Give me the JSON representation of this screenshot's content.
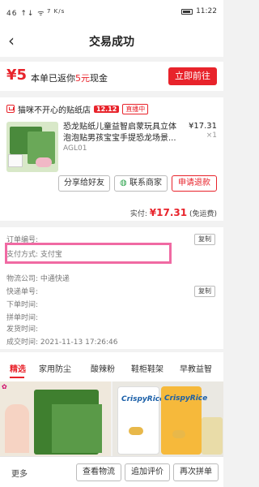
{
  "status_bar": {
    "signal": "46 ↑↓ ᯤ",
    "speed": "7 K/s",
    "time": "11:22"
  },
  "nav": {
    "title": "交易成功"
  },
  "promo": {
    "amount": "¥5",
    "text_before": "本单已返你",
    "highlight": "5元",
    "text_after": "现金",
    "button": "立即前往",
    "accent": "#e8232b"
  },
  "order": {
    "shop_name": "猫咪不开心的贴纸店",
    "badge_1212": "12.12",
    "live_badge": "直播中",
    "product_title": "恐龙贴纸儿童益智启蒙玩具立体泡泡贴男孩宝宝手提恐龙场景...",
    "product_sku": "AGL01",
    "price": "¥17.31",
    "qty": "×1",
    "actions": {
      "share": "分享给好友",
      "contact": "联系商家",
      "refund": "申请退款"
    }
  },
  "total": {
    "label": "实付:",
    "amount": "¥17.31",
    "note": "(免运费)"
  },
  "info": {
    "order_no_label": "订单编号:",
    "copy": "复制",
    "payment_method_label": "支付方式:",
    "payment_method_value": "支付宝",
    "logistics_label": "物流公司:",
    "logistics_value": "中通快递",
    "tracking_label": "快递单号:",
    "order_time_label": "下单时间:",
    "group_time_label": "拼单时间:",
    "ship_time_label": "发货时间:",
    "deal_time_label": "成交时间:",
    "deal_time_value": "2021-11-13 17:26:46"
  },
  "tabs": [
    "精选",
    "家用防尘",
    "酸辣粉",
    "鞋柜鞋架",
    "早教益智"
  ],
  "feed": {
    "bag_label": "CrispyRice"
  },
  "bottom_bar": {
    "more": "更多",
    "track": "查看物流",
    "review": "追加评价",
    "rebuy": "再次拼单"
  }
}
